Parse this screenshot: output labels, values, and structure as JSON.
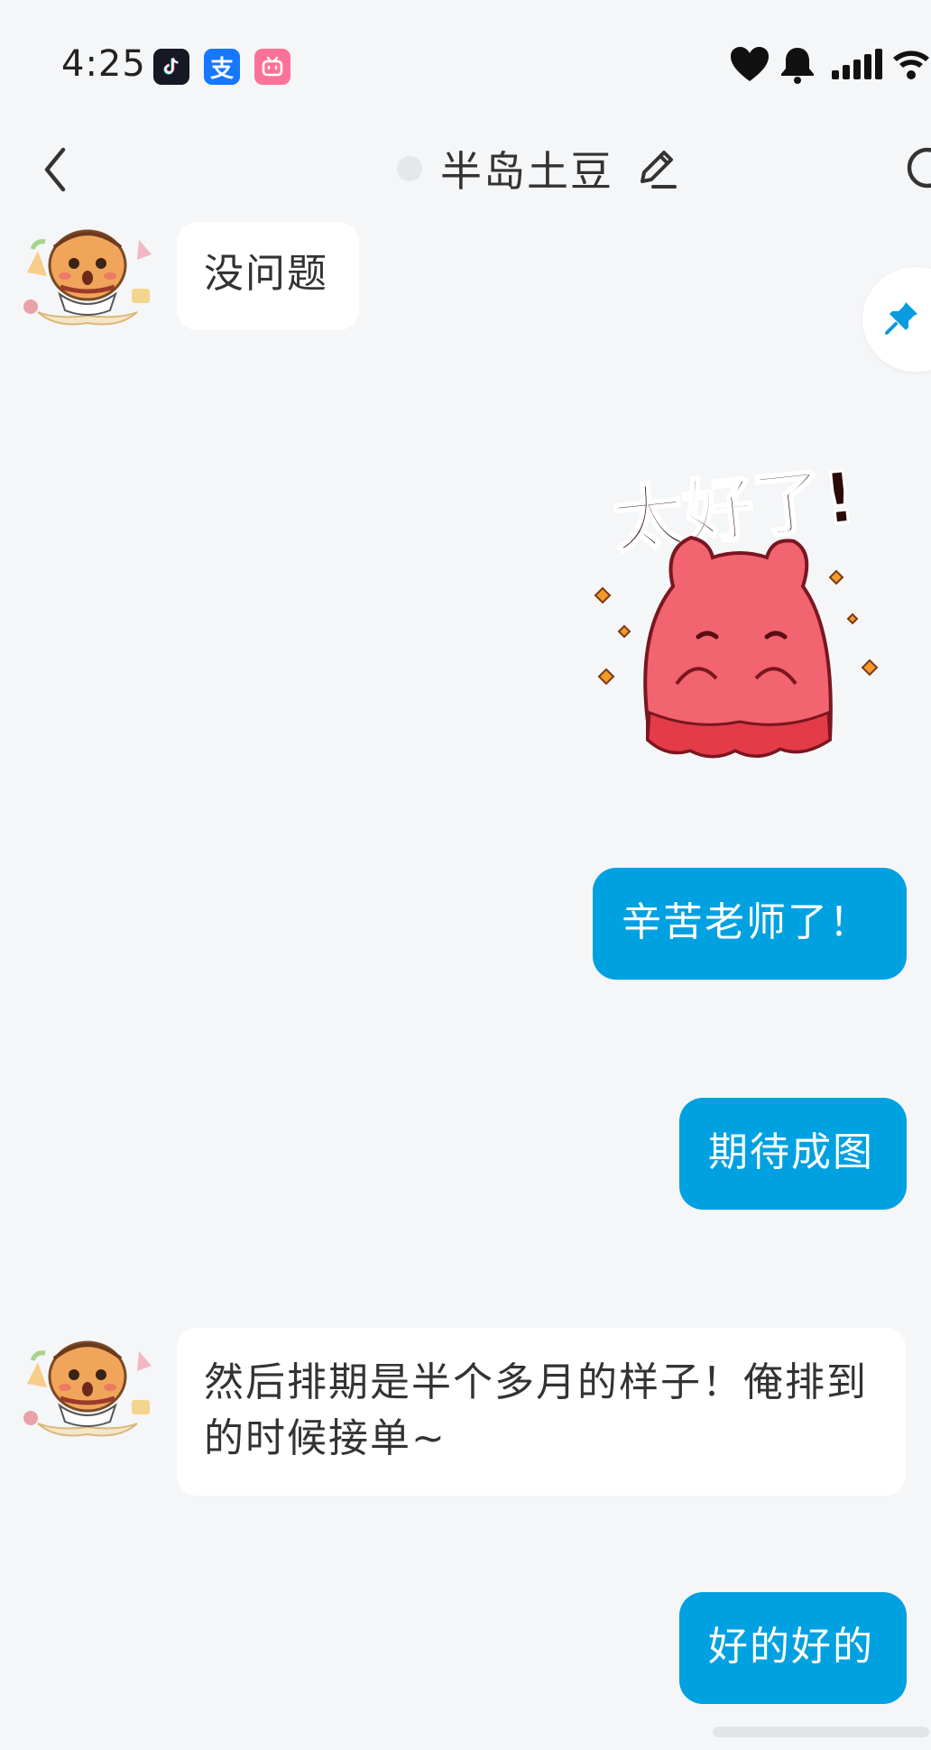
{
  "status_bar": {
    "time": "4:25",
    "apps": [
      {
        "name": "douyin-icon",
        "bg": "#161823"
      },
      {
        "name": "alipay-icon",
        "bg": "#1677ff",
        "glyph": "支"
      },
      {
        "name": "bilibili-icon",
        "bg": "#fb7299"
      }
    ]
  },
  "header": {
    "title": "半岛土豆"
  },
  "colors": {
    "accent": "#00a1e1",
    "background": "#f5f6f8",
    "incoming_bubble": "#ffffff"
  },
  "messages": [
    {
      "direction": "in",
      "text": "没问题"
    },
    {
      "direction": "out",
      "type": "sticker",
      "sticker_text": "太好了!"
    },
    {
      "direction": "out",
      "text": "辛苦老师了！"
    },
    {
      "direction": "out",
      "text": "期待成图"
    },
    {
      "direction": "in",
      "text": "然后排期是半个多月的样子！俺排到的时候接单~"
    },
    {
      "direction": "out",
      "text": "好的好的"
    }
  ]
}
